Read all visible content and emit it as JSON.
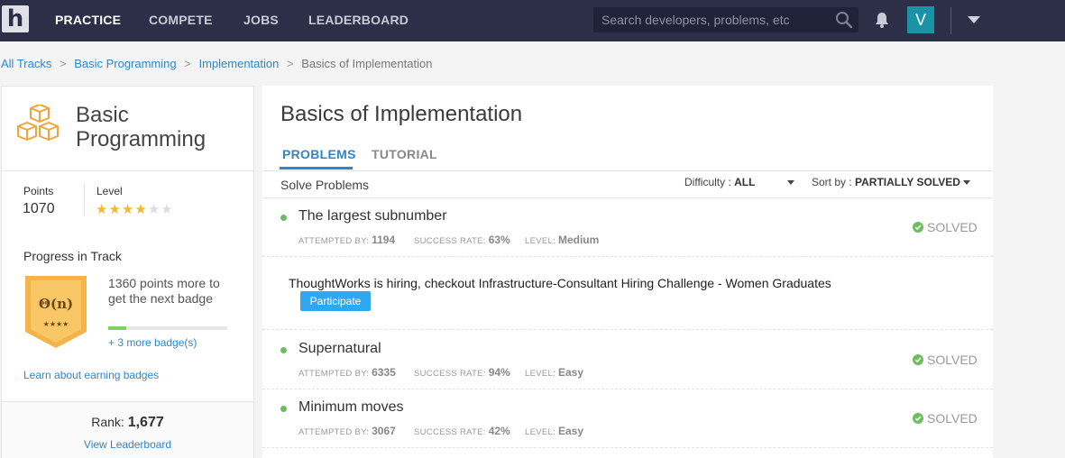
{
  "nav": {
    "items": [
      {
        "label": "PRACTICE",
        "active": true
      },
      {
        "label": "COMPETE",
        "active": false
      },
      {
        "label": "JOBS",
        "active": false
      },
      {
        "label": "LEADERBOARD",
        "active": false
      }
    ],
    "search_placeholder": "Search developers, problems, etc",
    "avatar_initial": "V",
    "colors": {
      "bar": "#2d2f48",
      "avatar": "#1b93a6"
    }
  },
  "breadcrumb": {
    "links": [
      "All Tracks",
      "Basic Programming",
      "Implementation"
    ],
    "current": "Basics of Implementation"
  },
  "track": {
    "title": "Basic Programming",
    "points_label": "Points",
    "points": "1070",
    "level_label": "Level",
    "level_stars": 4,
    "level_max": 6,
    "progress_title": "Progress in Track",
    "badge_symbol": "Θ(n)",
    "badge_stars": "★★★★",
    "badge_message": "1360 points more to get the next badge",
    "badge_progress": 0.15,
    "more_badges": "+ 3 more badge(s)",
    "learn_link": "Learn about earning badges",
    "rank_label": "Rank:",
    "rank_value": "1,677",
    "leaderboard_link": "View Leaderboard"
  },
  "main": {
    "title": "Basics of Implementation",
    "tabs": [
      {
        "label": "PROBLEMS",
        "active": true
      },
      {
        "label": "TUTORIAL",
        "active": false
      }
    ],
    "solve_label": "Solve Problems",
    "difficulty_label": "Difficulty :",
    "difficulty_value": "ALL",
    "sort_label": "Sort by :",
    "sort_value": "PARTIALLY SOLVED",
    "meta_labels": {
      "attempted": "ATTEMPTED BY:",
      "success": "SUCCESS RATE:",
      "level": "LEVEL:"
    },
    "problems": [
      {
        "title": "The largest subnumber",
        "attempted": "1194",
        "success_rate": "63%",
        "level": "Medium",
        "status": "SOLVED"
      },
      {
        "title": "Supernatural",
        "attempted": "6335",
        "success_rate": "94%",
        "level": "Easy",
        "status": "SOLVED"
      },
      {
        "title": "Minimum moves",
        "attempted": "3067",
        "success_rate": "42%",
        "level": "Easy",
        "status": "SOLVED"
      }
    ],
    "promo": {
      "text": "ThoughtWorks is hiring, checkout Infrastructure-Consultant Hiring Challenge - Women Graduates",
      "button": "Participate"
    },
    "colors": {
      "accent": "#2f86c9",
      "solved_dot": "#6abf5a",
      "button": "#2fa7f2"
    }
  }
}
